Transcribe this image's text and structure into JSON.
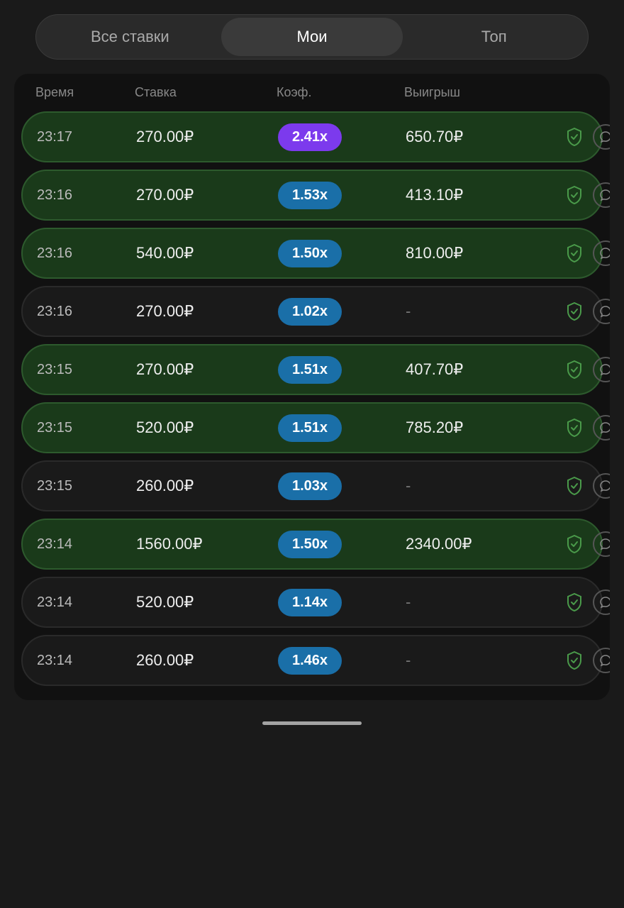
{
  "tabs": [
    {
      "label": "Все ставки",
      "active": false
    },
    {
      "label": "Мои",
      "active": true
    },
    {
      "label": "Топ",
      "active": false
    }
  ],
  "table": {
    "headers": [
      "Время",
      "Ставка",
      "Коэф.",
      "Выигрыш",
      ""
    ],
    "rows": [
      {
        "time": "23:17",
        "amount": "270.00₽",
        "coef": "2.41x",
        "coef_type": "purple",
        "winnings": "650.70₽",
        "win": true
      },
      {
        "time": "23:16",
        "amount": "270.00₽",
        "coef": "1.53x",
        "coef_type": "blue",
        "winnings": "413.10₽",
        "win": true
      },
      {
        "time": "23:16",
        "amount": "540.00₽",
        "coef": "1.50x",
        "coef_type": "blue",
        "winnings": "810.00₽",
        "win": true
      },
      {
        "time": "23:16",
        "amount": "270.00₽",
        "coef": "1.02x",
        "coef_type": "blue",
        "winnings": "-",
        "win": false
      },
      {
        "time": "23:15",
        "amount": "270.00₽",
        "coef": "1.51x",
        "coef_type": "blue",
        "winnings": "407.70₽",
        "win": true
      },
      {
        "time": "23:15",
        "amount": "520.00₽",
        "coef": "1.51x",
        "coef_type": "blue",
        "winnings": "785.20₽",
        "win": true
      },
      {
        "time": "23:15",
        "amount": "260.00₽",
        "coef": "1.03x",
        "coef_type": "blue",
        "winnings": "-",
        "win": false
      },
      {
        "time": "23:14",
        "amount": "1560.00₽",
        "coef": "1.50x",
        "coef_type": "blue",
        "winnings": "2340.00₽",
        "win": true
      },
      {
        "time": "23:14",
        "amount": "520.00₽",
        "coef": "1.14x",
        "coef_type": "blue",
        "winnings": "-",
        "win": false
      },
      {
        "time": "23:14",
        "amount": "260.00₽",
        "coef": "1.46x",
        "coef_type": "blue",
        "winnings": "-",
        "win": false
      }
    ]
  }
}
